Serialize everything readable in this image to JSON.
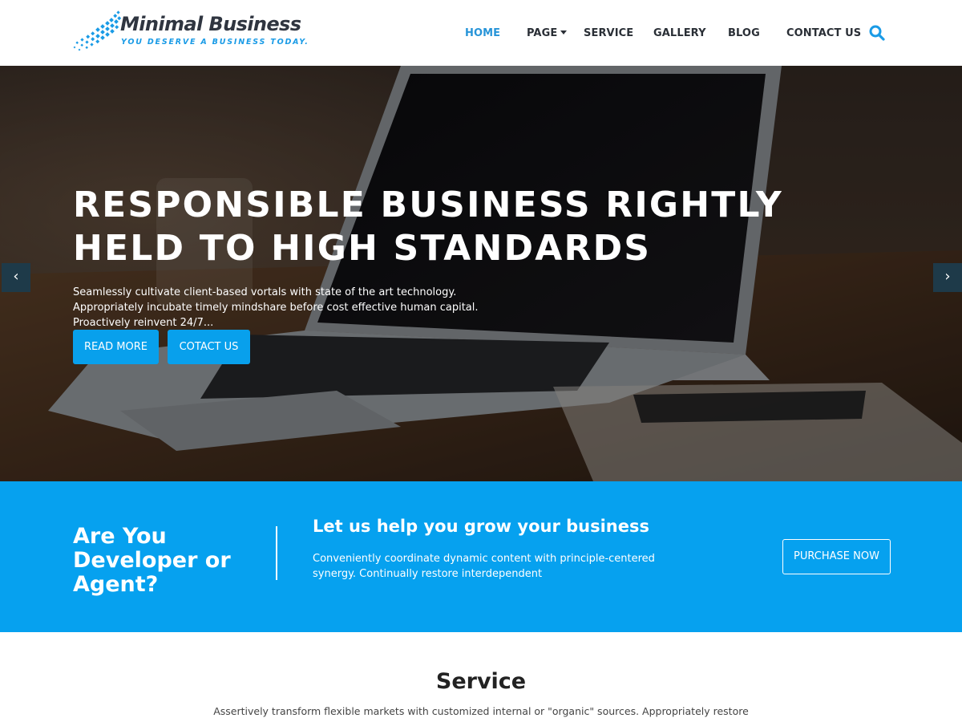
{
  "brand": {
    "name": "Minimal Business",
    "tagline": "YOU DESERVE A BUSINESS TODAY.",
    "accent_color": "#08a0ec"
  },
  "nav": {
    "home": "HOME",
    "page": "PAGE",
    "service": "SERVICE",
    "gallery": "GALLERY",
    "blog": "BLOG",
    "contact": "CONTACT US",
    "search_icon": "search-icon"
  },
  "hero": {
    "title": "RESPONSIBLE BUSINESS RIGHTLY HELD TO HIGH STANDARDS",
    "text": "Seamlessly cultivate client-based vortals with state of the art technology. Appropriately incubate timely mindshare before cost effective human capital. Proactively reinvent 24/7...",
    "read_more": "READ MORE",
    "contact": "COTACT US",
    "prev_icon": "chevron-left-icon",
    "next_icon": "chevron-right-icon"
  },
  "cta": {
    "heading": "Are You Developer or Agent?",
    "subheading": "Let us help you grow your business",
    "text": "Conveniently coordinate dynamic content with principle-centered synergy. Continually restore interdependent",
    "button": "PURCHASE NOW",
    "background_color": "#06a1ef"
  },
  "service": {
    "title": "Service",
    "text": "Assertively transform flexible markets with customized internal or \"organic\" sources. Appropriately restore"
  }
}
